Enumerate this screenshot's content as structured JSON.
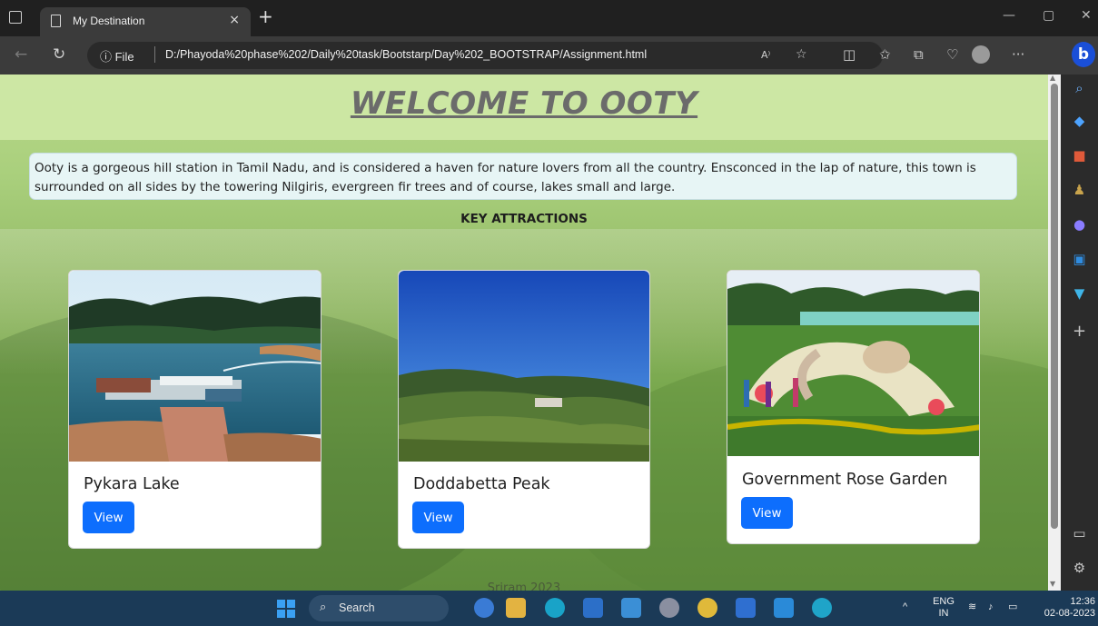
{
  "browser": {
    "tab_title": "My Destination",
    "tab_close": "×",
    "new_tab": "+",
    "address_prefix": "ⓘ File",
    "url": "D:/Phayoda%20phase%202/Daily%20task/Bootstarp/Day%202_BOOTSTRAP/Assignment.html",
    "more_menu": "···"
  },
  "page": {
    "title": "WELCOME TO OOTY",
    "intro": "Ooty is a gorgeous hill station in Tamil Nadu, and is considered a haven for nature lovers from all the country. Ensconced in the lap of nature, this town is surrounded on all sides by the towering Nilgiris, evergreen fir trees and of course, lakes small and large.",
    "section_heading": "KEY ATTRACTIONS",
    "cards": [
      {
        "title": "Pykara Lake",
        "button": "View"
      },
      {
        "title": "Doddabetta Peak",
        "button": "View"
      },
      {
        "title": "Government Rose Garden",
        "button": "View"
      }
    ],
    "footer": "Sriram 2023"
  },
  "taskbar": {
    "search_label": "Search",
    "language_line1": "ENG",
    "language_line2": "IN",
    "time": "12:36",
    "date": "02-08-2023"
  },
  "colors": {
    "primary_button": "#0d6efd",
    "title_gray": "#6b6b6b",
    "bing_blue": "#1a4fd8"
  }
}
